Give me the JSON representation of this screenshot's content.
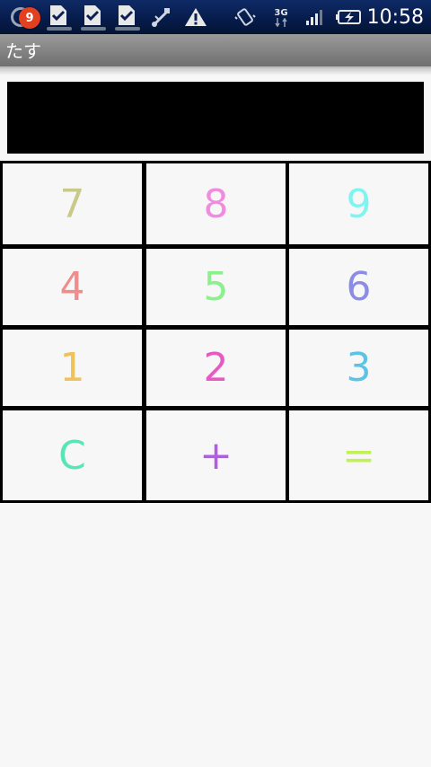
{
  "status_bar": {
    "notification_count": "9",
    "icons": [
      "notification-badge-icon",
      "download-done-icon",
      "download-done-icon",
      "download-done-icon",
      "usb-debug-icon",
      "warning-icon",
      "vibrate-icon",
      "network-3g-icon",
      "signal-icon",
      "battery-charging-icon"
    ],
    "network_label": "3G",
    "time": "10:58"
  },
  "app": {
    "title": "たす"
  },
  "display": {
    "value": ""
  },
  "keys": [
    {
      "label": "7",
      "color": "#c9c98a"
    },
    {
      "label": "8",
      "color": "#f08ce0"
    },
    {
      "label": "9",
      "color": "#7ff5f0"
    },
    {
      "label": "4",
      "color": "#f08c8c"
    },
    {
      "label": "5",
      "color": "#8cf08c"
    },
    {
      "label": "6",
      "color": "#8c8ce6"
    },
    {
      "label": "1",
      "color": "#f0c35a"
    },
    {
      "label": "2",
      "color": "#e65ac3"
    },
    {
      "label": "3",
      "color": "#5ac3e6"
    },
    {
      "label": "C",
      "color": "#5ae6b4"
    },
    {
      "label": "+",
      "color": "#b45ae6"
    },
    {
      "label": "=",
      "color": "#c3f05a"
    }
  ]
}
